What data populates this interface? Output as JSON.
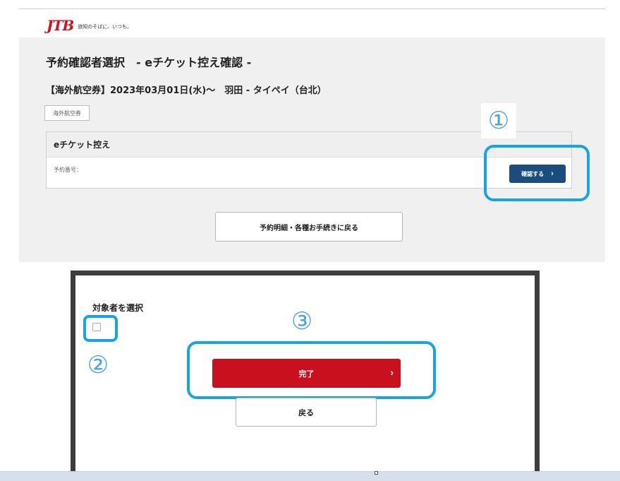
{
  "brand": {
    "logo_text": "JTB",
    "tagline": "旅知のそばに、いつも。",
    "color": "#d0111b"
  },
  "page": {
    "title": "予約確認者選択　- eチケット控え確認 -",
    "trip_info": "【海外航空券】2023年03月01日(水)～　羽田 - タイペイ（台北）",
    "tag": "海外航空券"
  },
  "eticket": {
    "heading": "eチケット控え",
    "booking_label": "予約番号：",
    "confirm_label": "確認する",
    "confirm_icon": "chevron-right-icon",
    "confirm_color": "#1a4c7e"
  },
  "back_to_details_label": "予約明細・各種お手続きに戻る",
  "annotations": {
    "step1": "①",
    "step2": "②",
    "step3": "③",
    "highlight_color": "#18a3e2"
  },
  "dialog": {
    "select_label": "対象者を選択",
    "done_label": "完了",
    "done_icon": "chevron-right-icon",
    "done_color": "#c8101e",
    "back_label": "戻る"
  }
}
